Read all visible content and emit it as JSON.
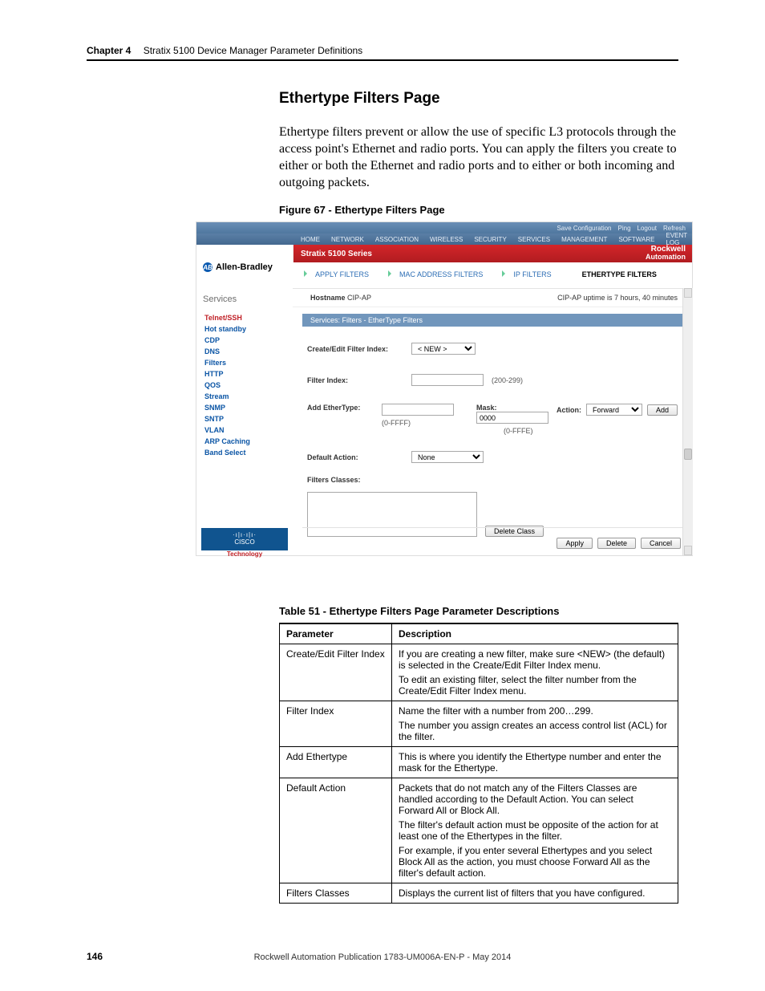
{
  "running_header": {
    "chapter": "Chapter 4",
    "title": "Stratix 5100 Device Manager Parameter Definitions"
  },
  "section_heading": "Ethertype Filters Page",
  "body_paragraph": "Ethertype filters prevent or allow the use of specific L3 protocols through the access point's Ethernet and radio ports. You can apply the filters you create to either or both the Ethernet and radio ports and to either or both incoming and outgoing packets.",
  "figure_caption": "Figure 67 - Ethertype Filters Page",
  "screenshot": {
    "top_links": [
      "Save Configuration",
      "Ping",
      "Logout",
      "Refresh"
    ],
    "nav": [
      "HOME",
      "NETWORK",
      "ASSOCIATION",
      "WIRELESS",
      "SECURITY",
      "SERVICES",
      "MANAGEMENT",
      "SOFTWARE",
      "EVENT LOG"
    ],
    "series_title": "Stratix 5100 Series",
    "brand_line1": "Rockwell",
    "brand_line2": "Automation",
    "ab_label": "Allen-Bradley",
    "sidebar_header": "Services",
    "sidebar_items": [
      {
        "label": "Telnet/SSH",
        "active": true
      },
      {
        "label": "Hot standby"
      },
      {
        "label": "CDP"
      },
      {
        "label": "DNS"
      },
      {
        "label": "Filters"
      },
      {
        "label": "HTTP"
      },
      {
        "label": "QOS"
      },
      {
        "label": "Stream"
      },
      {
        "label": "SNMP"
      },
      {
        "label": "SNTP"
      },
      {
        "label": "VLAN"
      },
      {
        "label": "ARP Caching"
      },
      {
        "label": "Band Select"
      }
    ],
    "cisco_bars": "·ı|ı·ı|ı·",
    "cisco_name": "CISCO",
    "cisco_tag": "Technology",
    "tabs": [
      "APPLY FILTERS",
      "MAC ADDRESS FILTERS",
      "IP FILTERS",
      "ETHERTYPE FILTERS"
    ],
    "active_tab_index": 3,
    "hostname_label": "Hostname",
    "hostname_value": "CIP-AP",
    "uptime": "CIP-AP uptime is 7 hours, 40 minutes",
    "section_band": "Services: Filters - EtherType Filters",
    "form": {
      "create_label": "Create/Edit Filter Index:",
      "create_value": "< NEW >",
      "filter_index_label": "Filter Index:",
      "filter_index_hint": "(200-299)",
      "add_label": "Add EtherType:",
      "add_range": "(0-FFFF)",
      "mask_label": "Mask:",
      "mask_value": "0000",
      "mask_range": "(0-FFFE)",
      "action_label": "Action:",
      "action_value": "Forward",
      "add_btn": "Add",
      "default_action_label": "Default Action:",
      "default_action_value": "None",
      "classes_label": "Filters Classes:",
      "delete_class_btn": "Delete Class",
      "apply_btn": "Apply",
      "delete_btn": "Delete",
      "cancel_btn": "Cancel"
    }
  },
  "table_caption": "Table 51 - Ethertype Filters Page Parameter Descriptions",
  "table": {
    "head": {
      "p": "Parameter",
      "d": "Description"
    },
    "rows": [
      {
        "p": "Create/Edit Filter Index",
        "d": [
          "If you are creating a new filter, make sure <NEW> (the default) is selected in the Create/Edit Filter Index menu.",
          "To edit an existing filter, select the filter number from the Create/Edit Filter Index menu."
        ]
      },
      {
        "p": "Filter Index",
        "d": [
          "Name the filter with a number from 200…299.",
          "The number you assign creates an access control list (ACL) for the filter."
        ]
      },
      {
        "p": "Add Ethertype",
        "d": [
          "This is where you identify the Ethertype number and enter the mask for the Ethertype."
        ]
      },
      {
        "p": "Default Action",
        "d": [
          "Packets that do not match any of the Filters Classes are handled according to the Default Action. You can select Forward All or Block All.",
          "The filter's default action must be opposite of the action for at least one of the Ethertypes in the filter.",
          "For example, if you enter several Ethertypes and you select Block All as the action, you must choose Forward All as the filter's default action."
        ]
      },
      {
        "p": "Filters Classes",
        "d": [
          "Displays the current list of filters that you have configured."
        ]
      }
    ]
  },
  "footer": {
    "page": "146",
    "pub": "Rockwell Automation Publication 1783-UM006A-EN-P - May 2014"
  }
}
